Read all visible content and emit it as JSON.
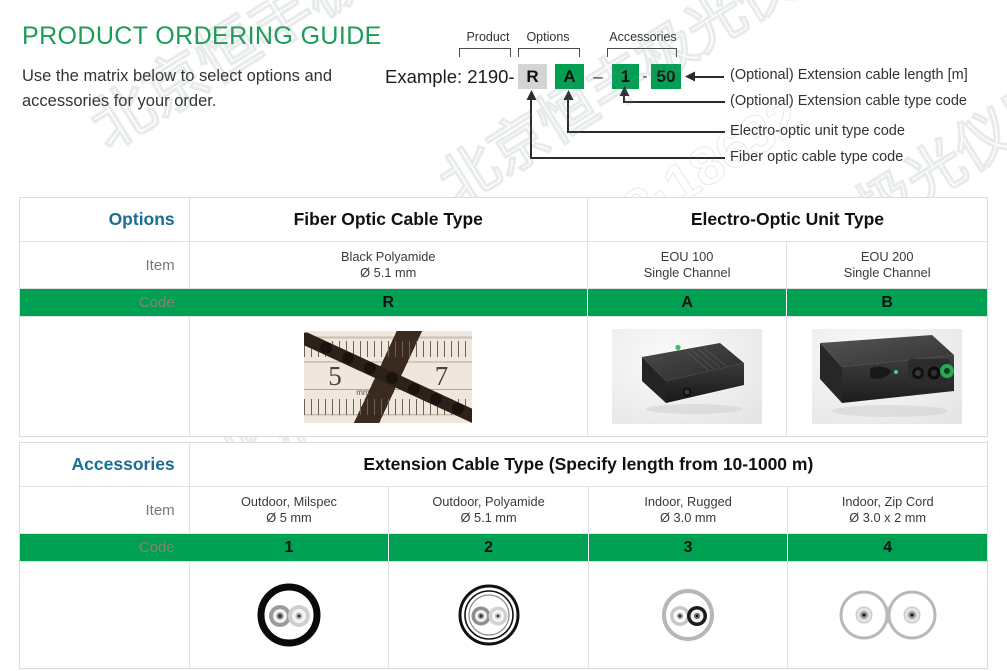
{
  "header": {
    "title": "PRODUCT ORDERING GUIDE",
    "subtitle": "Use the matrix below to select options and accessories for your order.",
    "title_color": "#1a9e57"
  },
  "example": {
    "prefix_label": "Example: 2190-",
    "bracket_labels": [
      "Product",
      "Options",
      "Accessories"
    ],
    "boxes": [
      {
        "value": "R",
        "style": "gray"
      },
      {
        "value": "A",
        "style": "green"
      },
      {
        "value": "1",
        "style": "green"
      },
      {
        "value": "50",
        "style": "green"
      }
    ],
    "separator_long": "–",
    "separator_short": "-",
    "annotations": [
      "(Optional) Extension cable length [m]",
      "(Optional) Extension cable type code",
      "Electro-optic unit type code",
      "Fiber optic cable type code"
    ]
  },
  "options_table": {
    "row_labels": {
      "section": "Options",
      "item": "Item",
      "code": "Code"
    },
    "group_headers": [
      {
        "text": "Fiber Optic Cable Type",
        "span": 1
      },
      {
        "text": "Electro-Optic Unit Type",
        "span": 2
      }
    ],
    "columns": [
      {
        "item_line1": "Black Polyamide",
        "item_line2": "Ø 5.1 mm",
        "code": "R",
        "image": "fiber-cable-ruler-photo"
      },
      {
        "item_line1": "EOU 100",
        "item_line2": "Single Channel",
        "code": "A",
        "image": "eou-100-photo"
      },
      {
        "item_line1": "EOU 200",
        "item_line2": "Single Channel",
        "code": "B",
        "image": "eou-200-photo"
      }
    ]
  },
  "accessories_table": {
    "row_labels": {
      "section": "Accessories",
      "item": "Item",
      "code": "Code"
    },
    "group_header": "Extension Cable Type (Specify length from 10-1000 m)",
    "columns": [
      {
        "item_line1": "Outdoor, Milspec",
        "item_line2": "Ø 5 mm",
        "code": "1",
        "image": "cable-cross-section-milspec"
      },
      {
        "item_line1": "Outdoor, Polyamide",
        "item_line2": "Ø 5.1 mm",
        "code": "2",
        "image": "cable-cross-section-polyamide"
      },
      {
        "item_line1": "Indoor, Rugged",
        "item_line2": "Ø 3.0 mm",
        "code": "3",
        "image": "cable-cross-section-rugged"
      },
      {
        "item_line1": "Indoor, Zip Cord",
        "item_line2": "Ø 3.0 x 2 mm",
        "code": "4",
        "image": "cable-cross-section-zipcord"
      }
    ]
  },
  "ruler_photo": {
    "mark_left": "5",
    "mark_right": "7",
    "unit": "mm"
  },
  "colors": {
    "green": "#00a053",
    "title_green": "#1a9e57",
    "section_blue": "#1a6e96",
    "code_label": "#8a7f72",
    "gray_box": "#d4d4d4"
  },
  "watermark_text": "北京恒丰极光仪器 18·18632"
}
